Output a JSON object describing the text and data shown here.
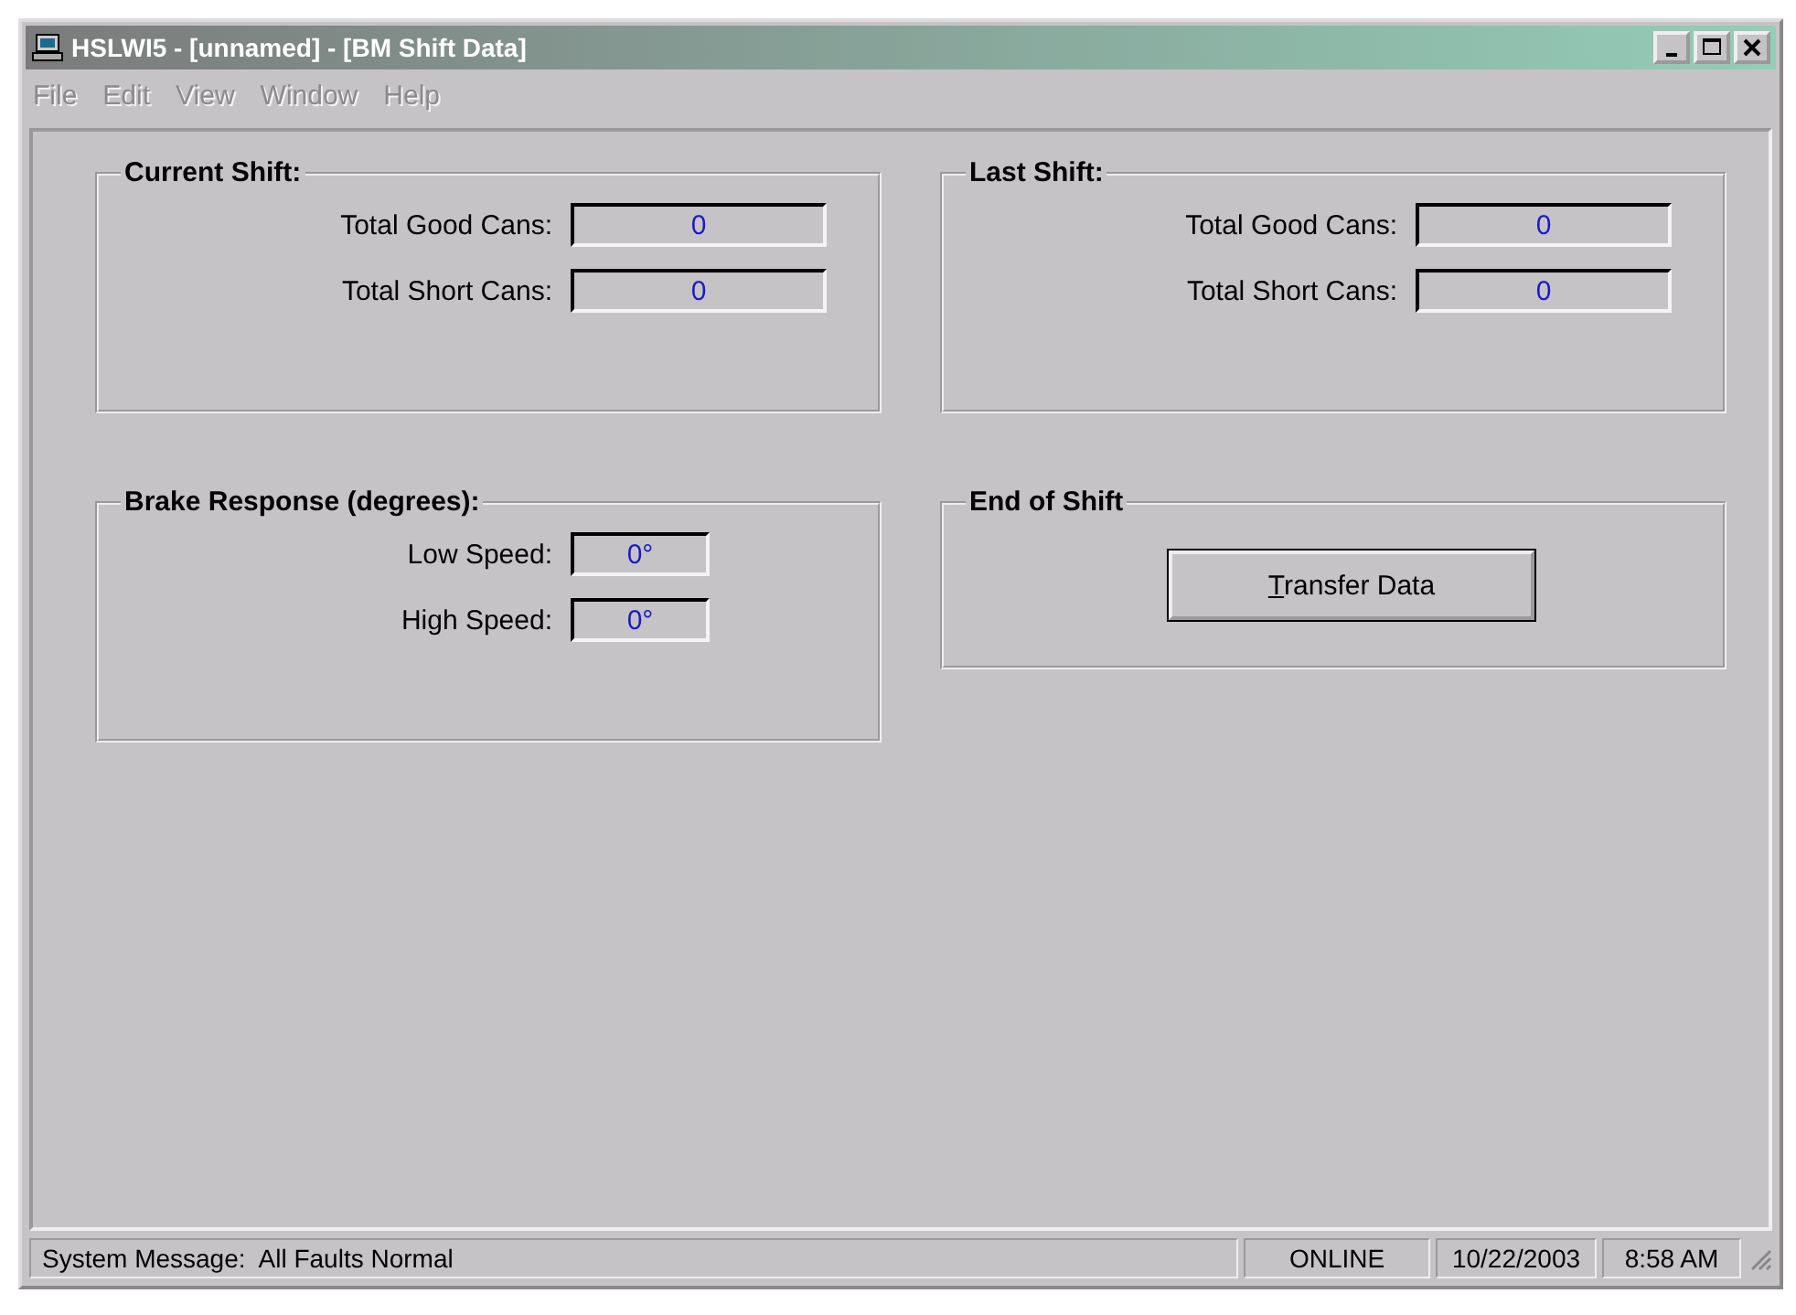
{
  "window": {
    "title": "HSLWI5 - [unnamed] - [BM Shift Data]"
  },
  "menu": [
    {
      "label": "File",
      "disabled": true
    },
    {
      "label": "Edit",
      "disabled": true
    },
    {
      "label": "View",
      "disabled": true
    },
    {
      "label": "Window",
      "disabled": true
    },
    {
      "label": "Help",
      "disabled": true
    }
  ],
  "groups": [
    {
      "title": "Current Shift:",
      "kind": "counts",
      "fields": [
        {
          "label": "Total Good Cans:",
          "value": "0"
        },
        {
          "label": "Total Short Cans:",
          "value": "0"
        }
      ]
    },
    {
      "title": "Last Shift:",
      "kind": "counts",
      "fields": [
        {
          "label": "Total Good Cans:",
          "value": "0"
        },
        {
          "label": "Total Short Cans:",
          "value": "0"
        }
      ]
    },
    {
      "title": "Brake Response (degrees):",
      "kind": "angles",
      "fields": [
        {
          "label": "Low Speed:",
          "value": "0°"
        },
        {
          "label": "High Speed:",
          "value": "0°"
        }
      ]
    },
    {
      "title": "End of Shift",
      "kind": "action",
      "button": {
        "label": "Transfer Data"
      }
    }
  ],
  "status_bar": {
    "message": "System Message:  All Faults Normal",
    "mode": "ONLINE",
    "date": "10/22/2003",
    "time": "8:58 AM"
  }
}
